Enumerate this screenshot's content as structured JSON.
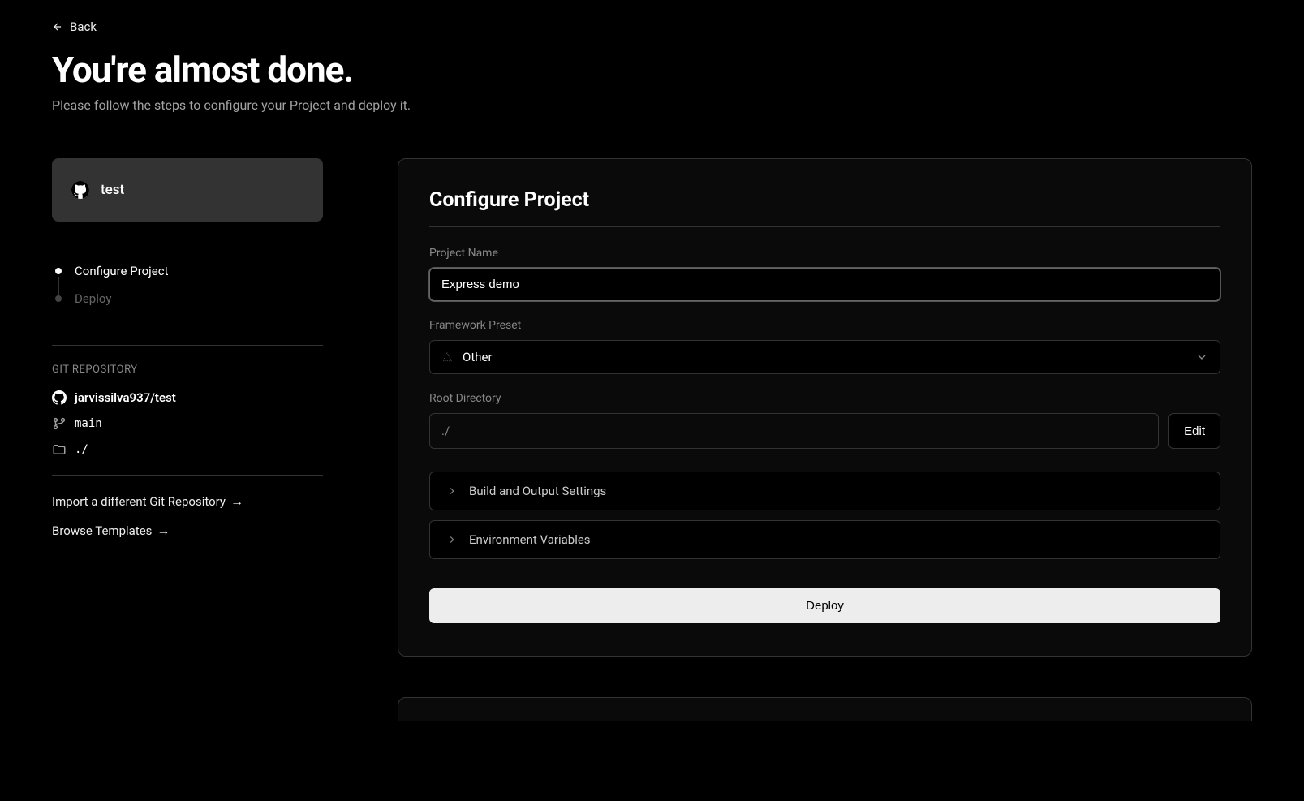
{
  "back": {
    "label": "Back"
  },
  "header": {
    "title": "You're almost done.",
    "subtitle": "Please follow the steps to configure your Project and deploy it."
  },
  "sidebar": {
    "repo_card": {
      "name": "test"
    },
    "steps": [
      {
        "label": "Configure Project"
      },
      {
        "label": "Deploy"
      }
    ],
    "git_repo_label": "GIT REPOSITORY",
    "repo_full": "jarvissilva937/test",
    "branch": "main",
    "folder": "./",
    "import_link": "Import a different Git Repository",
    "browse_link": "Browse Templates"
  },
  "panel": {
    "title": "Configure Project",
    "project_name_label": "Project Name",
    "project_name_value": "Express demo",
    "framework_label": "Framework Preset",
    "framework_value": "Other",
    "root_dir_label": "Root Directory",
    "root_dir_value": "./",
    "edit_label": "Edit",
    "build_settings_label": "Build and Output Settings",
    "env_vars_label": "Environment Variables",
    "deploy_label": "Deploy"
  }
}
